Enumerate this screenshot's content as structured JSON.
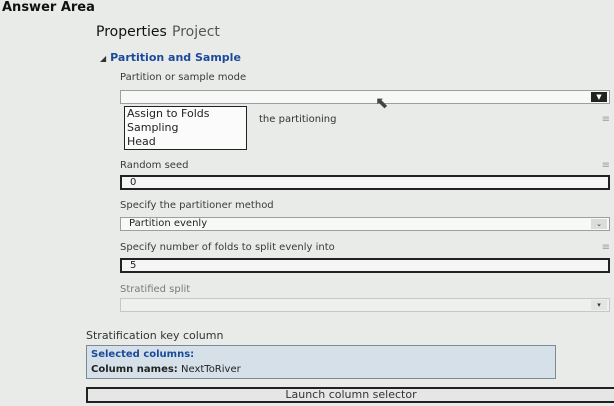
{
  "answer_area": {
    "title": "Answer Area"
  },
  "tabs": [
    {
      "label": "Properties"
    },
    {
      "label": "Project"
    }
  ],
  "section": {
    "title": "Partition and Sample"
  },
  "partition_mode": {
    "label": "Partition or sample mode",
    "options": [
      "Assign to Folds",
      "Sampling",
      "Head"
    ],
    "hidden_text_fragment": "the partitioning"
  },
  "random_seed": {
    "label": "Random seed",
    "value": "0"
  },
  "partitioner_method": {
    "label": "Specify the partitioner method",
    "value": "Partition evenly"
  },
  "folds": {
    "label": "Specify number of folds to split evenly into",
    "value": "5"
  },
  "stratified_split": {
    "label": "Stratified split",
    "value": ""
  },
  "stratification": {
    "label": "Stratification key column",
    "selected_title": "Selected columns:",
    "column_names_label": "Column names:",
    "column_names_value": "NextToRiver",
    "launch_label": "Launch column selector"
  }
}
